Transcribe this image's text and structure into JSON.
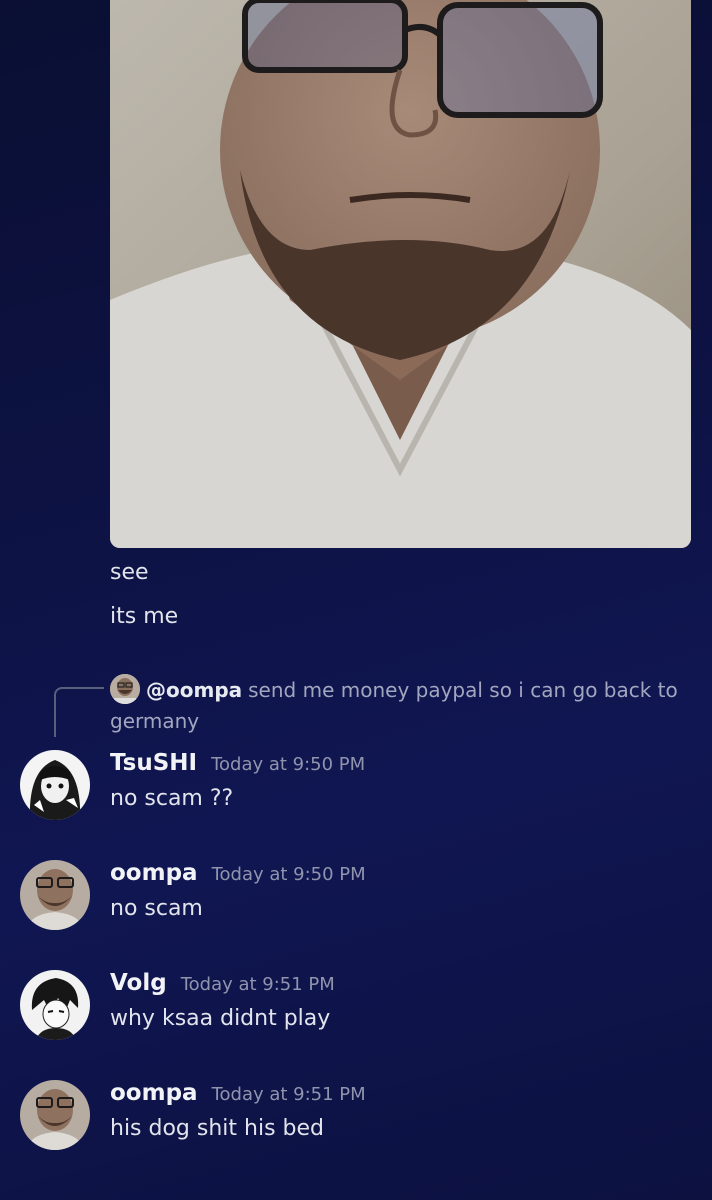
{
  "image_message": {
    "lines": [
      "see",
      "its me"
    ]
  },
  "reply": {
    "mention": "@oompa",
    "text": "send me money paypal so i can go back to germany"
  },
  "messages": [
    {
      "author": "TsuSHI",
      "time": "Today at 9:50 PM",
      "text": "no scam ??",
      "avatar": "anime-girl-avatar"
    },
    {
      "author": "oompa",
      "time": "Today at 9:50 PM",
      "text": "no scam",
      "avatar": "man-glasses-avatar"
    },
    {
      "author": "Volg",
      "time": "Today at 9:51 PM",
      "text": "why ksaa didnt play",
      "avatar": "manga-boy-avatar"
    },
    {
      "author": "oompa",
      "time": "Today at 9:51 PM",
      "text": "his dog shit his bed",
      "avatar": "man-glasses-avatar"
    }
  ]
}
